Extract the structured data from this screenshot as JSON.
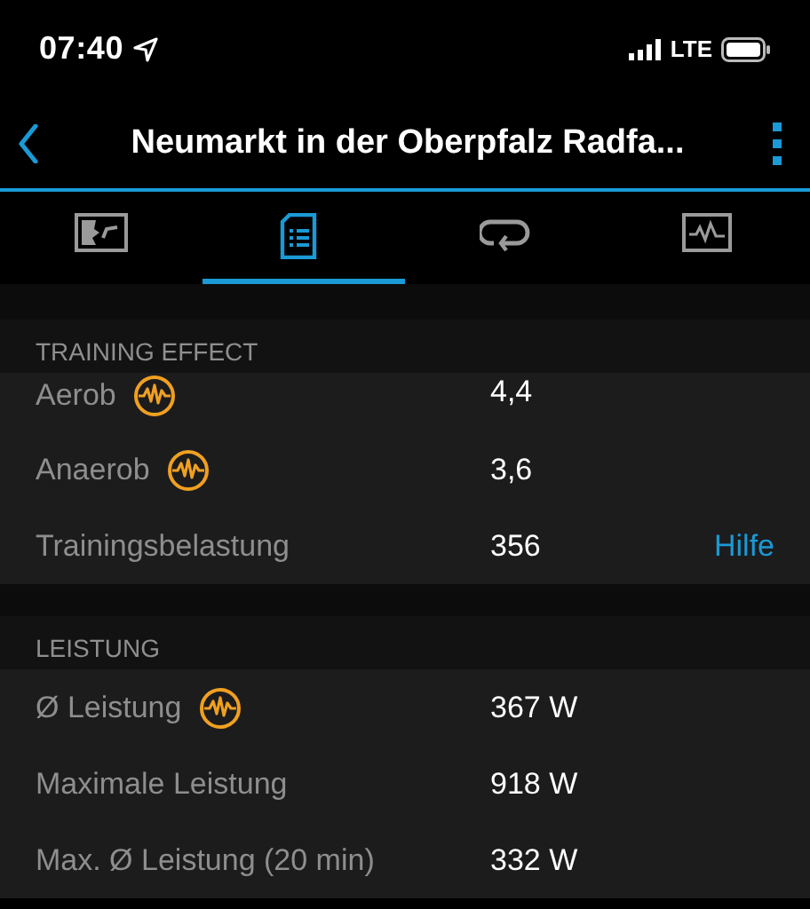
{
  "status_bar": {
    "time": "07:40",
    "network": "LTE"
  },
  "nav": {
    "title": "Neumarkt in der Oberpfalz Radfa..."
  },
  "tabs": [
    {
      "kind": "map",
      "selected": false
    },
    {
      "kind": "summary",
      "selected": true
    },
    {
      "kind": "laps",
      "selected": false
    },
    {
      "kind": "chart",
      "selected": false
    }
  ],
  "sections": [
    {
      "title": "TRAINING EFFECT",
      "rows": [
        {
          "label": "Aerob",
          "badge": true,
          "value": "4,4"
        },
        {
          "label": "Anaerob",
          "badge": true,
          "value": "3,6"
        },
        {
          "label": "Trainingsbelastung",
          "badge": false,
          "value": "356",
          "link": "Hilfe"
        }
      ]
    },
    {
      "title": "LEISTUNG",
      "rows": [
        {
          "label": "Ø Leistung",
          "badge": true,
          "value": "367 W"
        },
        {
          "label": "Maximale Leistung",
          "badge": false,
          "value": "918 W"
        },
        {
          "label": "Max. Ø Leistung (20 min)",
          "badge": false,
          "value": "332 W"
        }
      ]
    }
  ]
}
